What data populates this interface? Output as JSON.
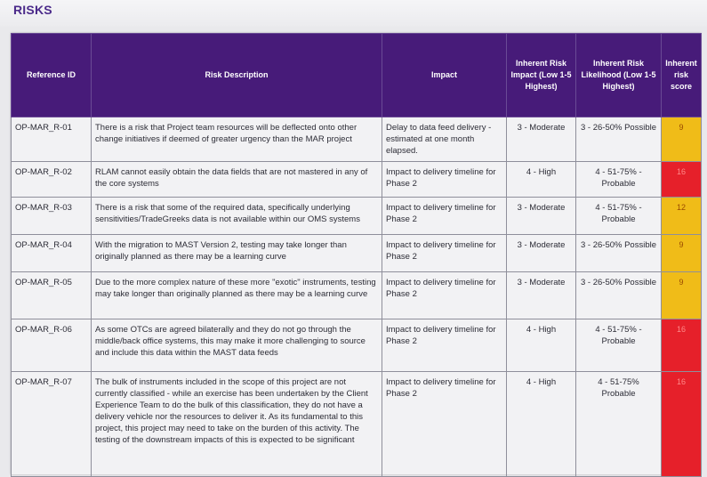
{
  "page": {
    "title": "RISKS"
  },
  "colors": {
    "header_bg": "#471b79",
    "score_moderate": "#f0bc18",
    "score_high": "#e6202a"
  },
  "table": {
    "headers": [
      "Reference ID",
      "Risk Description",
      "Impact",
      "Inherent Risk Impact (Low 1-5 Highest)",
      "Inherent Risk Likelihood (Low 1-5 Highest)",
      "Inherent risk score"
    ],
    "rows": [
      {
        "ref": "OP-MAR_R-01",
        "description": "There is a risk that Project team resources will be deflected onto other change initiatives if deemed of greater urgency than the MAR project",
        "impact": "Delay to data feed delivery - estimated at one month elapsed.",
        "inherent_impact": "3 - Moderate",
        "likelihood": "3 - 26-50% Possible",
        "score": "9",
        "level": "amber"
      },
      {
        "ref": "OP-MAR_R-02",
        "description": "RLAM cannot easily obtain the data fields that are not mastered in any of the core systems",
        "impact": "Impact to delivery timeline for Phase 2",
        "inherent_impact": "4 - High",
        "likelihood": "4 - 51-75% - Probable",
        "score": "16",
        "level": "red"
      },
      {
        "ref": "OP-MAR_R-03",
        "description": "There is a risk that some of the required data, specifically underlying sensitivities/TradeGreeks data is not available within our OMS systems",
        "impact": "Impact to delivery timeline for Phase 2",
        "inherent_impact": "3 - Moderate",
        "likelihood": "4 - 51-75% - Probable",
        "score": "12",
        "level": "amber"
      },
      {
        "ref": "OP-MAR_R-04",
        "description": "With the migration to MAST Version 2, testing may take longer than originally planned as there may be a learning curve",
        "impact": "Impact to delivery timeline for Phase 2",
        "inherent_impact": "3 - Moderate",
        "likelihood": "3 - 26-50% Possible",
        "score": "9",
        "level": "amber"
      },
      {
        "ref": "OP-MAR_R-05",
        "description": "Due to the more complex nature of these more \"exotic\" instruments, testing may take longer than originally planned as there may be a learning curve",
        "impact": "Impact to delivery timeline for Phase 2",
        "inherent_impact": "3 - Moderate",
        "likelihood": "3 - 26-50% Possible",
        "score": "9",
        "level": "amber"
      },
      {
        "ref": "OP-MAR_R-06",
        "description": "As some OTCs are agreed bilaterally and they do not go through the middle/back office systems, this may make it more challenging to source and include this data within the MAST data feeds",
        "impact": "Impact to delivery timeline for Phase 2",
        "inherent_impact": "4 - High",
        "likelihood": "4 - 51-75% - Probable",
        "score": "16",
        "level": "red"
      },
      {
        "ref": "OP-MAR_R-07",
        "description": "The bulk of instruments included in the scope of this project are not currently classified - while an exercise has been undertaken by the Client Experience Team to do the bulk of this classification, they do not have a delivery vehicle nor the resources to deliver it. As its fundamental to this project, this project may need to take on the burden of this activity. The testing of the downstream impacts of this is expected to be significant",
        "impact": "Impact to delivery timeline for Phase 2",
        "inherent_impact": "4 - High",
        "likelihood": "4 - 51-75% Probable",
        "score": "16",
        "level": "red"
      }
    ]
  }
}
